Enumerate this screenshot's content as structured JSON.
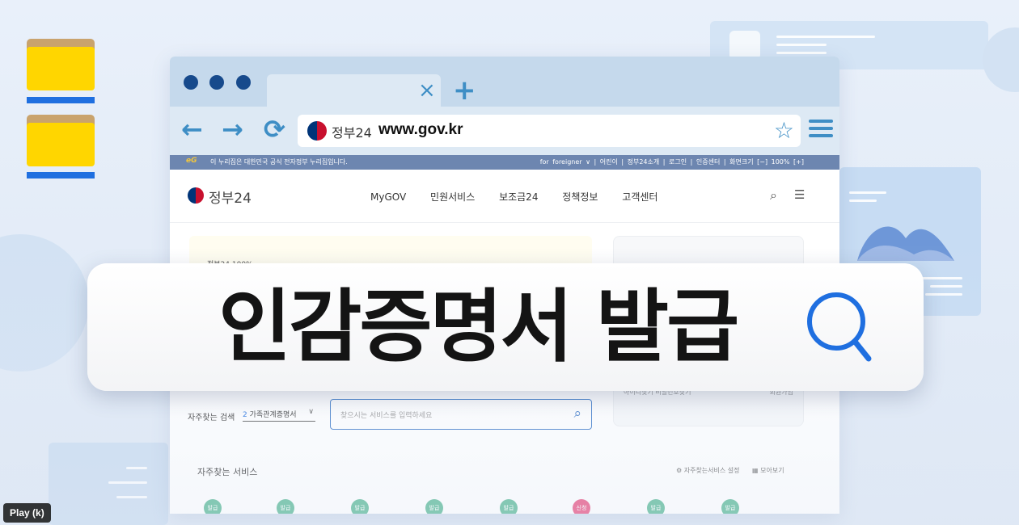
{
  "browser": {
    "close_tab": "×",
    "new_tab": "+",
    "site_name": "정부24",
    "url": "www.gov.kr"
  },
  "webpage": {
    "notice": "이 누리집은 대한민국 공식 전자정부 누리집입니다.",
    "eg_mark": "eG",
    "utility": [
      "for foreigner",
      "어린이",
      "정부24소개",
      "로그인",
      "인증센터",
      "화면크기",
      "100%"
    ],
    "logo_text": "정부24",
    "nav": [
      "MyGOV",
      "민원서비스",
      "보조금24",
      "정책정보",
      "고객센터"
    ],
    "banner_small_text": "정부24 100%...",
    "side_links": "아이디찾기   비밀번호찾기",
    "side_join": "회원가입",
    "fav_search_label": "자주찾는 검색",
    "fav_search_num": "2",
    "fav_search_value": "가족관계증명서",
    "search_placeholder": "찾으시는 서비스를 입력하세요",
    "services_title": "자주찾는 서비스",
    "services_setting": "자주찾는서비스 설정",
    "services_more": "모아보기",
    "service_badges": [
      "발급",
      "발급",
      "발급",
      "발급",
      "발급",
      "신청",
      "발급",
      "발급"
    ]
  },
  "overlay": {
    "title": "인감증명서 발급"
  },
  "tooltip": {
    "play": "Play (k)"
  },
  "colors": {
    "accent_blue": "#1f6fe0",
    "browser_icon": "#3e8ec5",
    "folder_yellow": "#ffd600",
    "badge_green": "#58b895",
    "badge_pink": "#e84e7e"
  }
}
